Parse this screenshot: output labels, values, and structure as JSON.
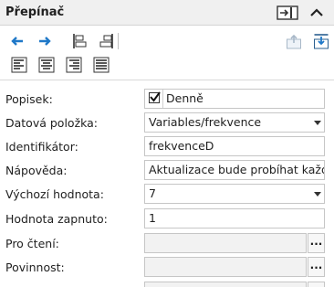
{
  "panel": {
    "title": "Přepínač"
  },
  "icons": {
    "pin": "dock-panel-icon",
    "collapse": "chevron-up-icon",
    "move_left": "arrow-left-icon",
    "move_right": "arrow-right-icon",
    "align_left_edge": "align-left-edge-icon",
    "align_right_edge": "align-right-edge-icon",
    "text_left": "text-align-left-icon",
    "text_center": "text-align-center-icon",
    "text_right": "text-align-right-icon",
    "text_justify": "text-align-justify-icon",
    "export": "export-icon",
    "import": "import-icon"
  },
  "properties": {
    "popisek": {
      "label": "Popisek:",
      "checked": true,
      "value": "Denně"
    },
    "datova_polozka": {
      "label": "Datová položka:",
      "value": "Variables/frekvence"
    },
    "identifikator": {
      "label": "Identifikátor:",
      "value": "frekvenceD"
    },
    "napoveda": {
      "label": "Nápověda:",
      "value": "Aktualizace bude probíhat každý den"
    },
    "vychozi_hodnota": {
      "label": "Výchozí hodnota:",
      "value": "7"
    },
    "hodnota_zapnuto": {
      "label": "Hodnota zapnuto:",
      "value": "1"
    },
    "pro_cteni": {
      "label": "Pro čtení:",
      "value": "",
      "button": "..."
    },
    "povinnost": {
      "label": "Povinnost:",
      "value": "",
      "button": "..."
    }
  },
  "colors": {
    "accent": "#1f78c8",
    "header_bg": "#f0f0f0"
  }
}
